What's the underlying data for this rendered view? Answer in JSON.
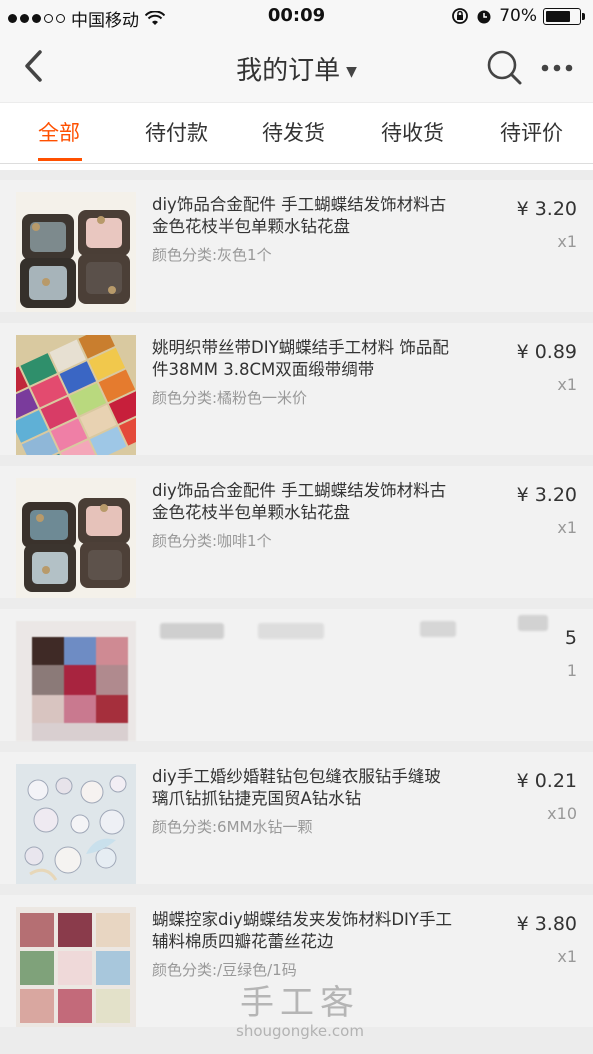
{
  "status_bar": {
    "carrier": "中国移动",
    "time": "00:09",
    "battery": "70%"
  },
  "nav": {
    "title": "我的订单",
    "back_icon": "chevron-left-icon",
    "search_icon": "search-icon",
    "more_icon": "more-icon"
  },
  "tabs": [
    {
      "label": "全部"
    },
    {
      "label": "待付款"
    },
    {
      "label": "待发货"
    },
    {
      "label": "待收货"
    },
    {
      "label": "待评价"
    }
  ],
  "accent_color": "#ff5000",
  "items": [
    {
      "title": "diy饰品合金配件 手工蝴蝶结发饰材料古金色花枝半包单颗水钻花盘",
      "variant": "颜色分类:灰色1个",
      "price": "¥ 3.20",
      "qty": "x1"
    },
    {
      "title": "姚明织带丝带DIY蝴蝶结手工材料 饰品配件38MM 3.8CM双面缎带绸带",
      "variant": "颜色分类:橘粉色一米价",
      "price": "¥ 0.89",
      "qty": "x1"
    },
    {
      "title": "diy饰品合金配件 手工蝴蝶结发饰材料古金色花枝半包单颗水钻花盘",
      "variant": "颜色分类:咖啡1个",
      "price": "¥ 3.20",
      "qty": "x1"
    },
    {
      "title": "",
      "variant": "",
      "price": "5",
      "qty": "1"
    },
    {
      "title": "diy手工婚纱婚鞋钻包包缝衣服钻手缝玻璃爪钻抓钻捷克国贸A钻水钻",
      "variant": "颜色分类:6MM水钻一颗",
      "price": "¥ 0.21",
      "qty": "x10"
    },
    {
      "title": "蝴蝶控家diy蝴蝶结发夹发饰材料DIY手工辅料棉质四瓣花蕾丝花边",
      "variant": "颜色分类:/豆绿色/1码",
      "price": "¥ 3.80",
      "qty": "x1"
    }
  ],
  "watermark": {
    "text": "手工客",
    "url": "shougongke.com"
  }
}
